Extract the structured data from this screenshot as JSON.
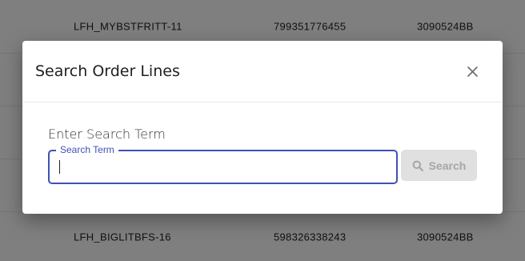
{
  "background_table": {
    "rows": [
      {
        "code": "LFH_MYBSTFRITT-11",
        "number": "799351776455",
        "ref": "3090524BB"
      },
      {
        "code": "",
        "number": "",
        "ref": ""
      },
      {
        "code": "",
        "number": "",
        "ref": ""
      },
      {
        "code": "",
        "number": "",
        "ref": ""
      },
      {
        "code": "LFH_BIGLITBFS-16",
        "number": "598326338243",
        "ref": "3090524BB"
      }
    ]
  },
  "dialog": {
    "title": "Search Order Lines",
    "close_icon": "close-icon",
    "prompt": "Enter Search Term",
    "field": {
      "label": "Search Term",
      "value": "",
      "placeholder": ""
    },
    "search_button": {
      "label": "Search",
      "icon": "search-icon",
      "disabled": true
    }
  },
  "colors": {
    "accent": "#3f51b5",
    "backdrop": "rgba(0,0,0,0.5)",
    "button_disabled_bg": "#e0e0e0",
    "button_disabled_text": "#a6a6a6"
  }
}
